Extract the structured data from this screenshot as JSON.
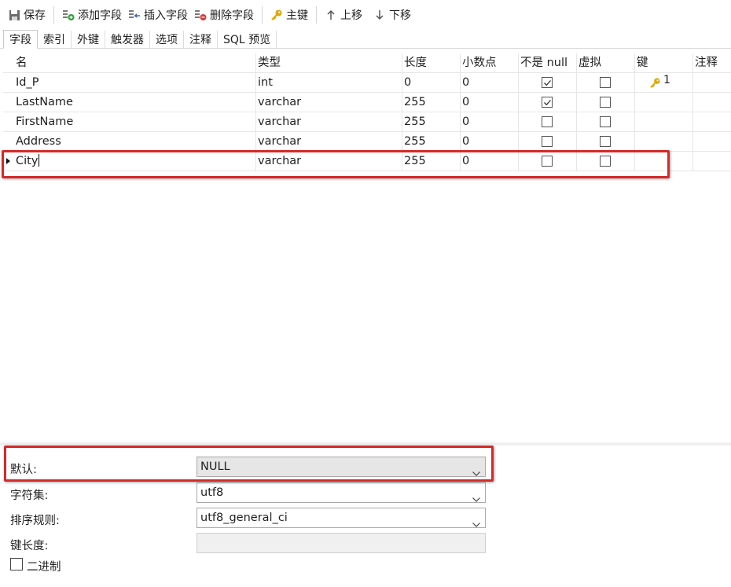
{
  "toolbar": {
    "save": "保存",
    "add_field": "添加字段",
    "insert_field": "插入字段",
    "delete_field": "删除字段",
    "primary_key": "主键",
    "move_up": "上移",
    "move_down": "下移"
  },
  "tabs": [
    "字段",
    "索引",
    "外键",
    "触发器",
    "选项",
    "注释",
    "SQL 预览"
  ],
  "grid": {
    "columns": [
      "名",
      "类型",
      "长度",
      "小数点",
      "不是 null",
      "虚拟",
      "键",
      "注释"
    ],
    "rows": [
      {
        "name": "Id_P",
        "type": "int",
        "length": "0",
        "decimals": "0",
        "not_null": true,
        "virtual": false,
        "key": "1"
      },
      {
        "name": "LastName",
        "type": "varchar",
        "length": "255",
        "decimals": "0",
        "not_null": true,
        "virtual": false,
        "key": ""
      },
      {
        "name": "FirstName",
        "type": "varchar",
        "length": "255",
        "decimals": "0",
        "not_null": false,
        "virtual": false,
        "key": ""
      },
      {
        "name": "Address",
        "type": "varchar",
        "length": "255",
        "decimals": "0",
        "not_null": false,
        "virtual": false,
        "key": ""
      },
      {
        "name": "City",
        "type": "varchar",
        "length": "255",
        "decimals": "0",
        "not_null": false,
        "virtual": false,
        "key": ""
      }
    ]
  },
  "properties": {
    "default_label": "默认:",
    "default_value": "NULL",
    "charset_label": "字符集:",
    "charset_value": "utf8",
    "collation_label": "排序规则:",
    "collation_value": "utf8_general_ci",
    "key_length_label": "键长度:",
    "key_length_value": "",
    "binary_label": "二进制"
  },
  "colors": {
    "highlight": "#d42a2a",
    "key_icon": "#d4a017"
  }
}
